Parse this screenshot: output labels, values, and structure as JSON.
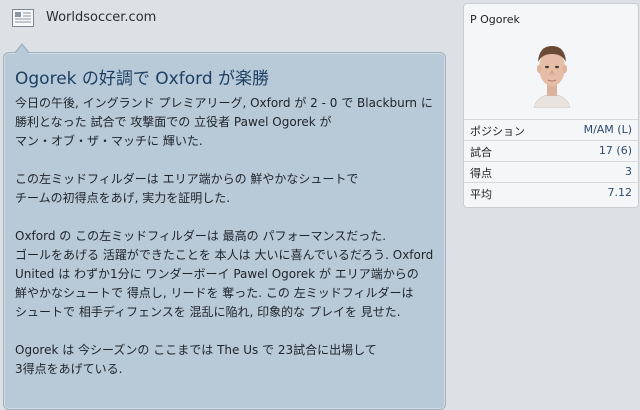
{
  "news": {
    "source": "Worldsoccer.com",
    "headline": "Ogorek の好調で Oxford が楽勝",
    "paragraphs": [
      [
        "今日の午後, イングランド プレミアリーグ, Oxford が 2 - 0 で Blackburn に",
        "勝利となった 試合で 攻撃面での 立役者 Pawel Ogorek が",
        "マン・オブ・ザ・マッチに 輝いた."
      ],
      [
        "この左ミッドフィルダーは エリア端からの 鮮やかなシュートで",
        "チームの初得点をあげ, 実力を証明した."
      ],
      [
        "Oxford の この左ミッドフィルダーは 最高の パフォーマンスだった.",
        "ゴールをあげる 活躍ができたことを 本人は 大いに喜んでいるだろう. Oxford",
        "United は わずか1分に ワンダーボーイ Pawel Ogorek が エリア端からの",
        "鮮やかなシュートで 得点し, リードを 奪った. この 左ミッドフィルダーは",
        "シュートで 相手ディフェンスを 混乱に陥れ, 印象的な プレイを 見せた."
      ],
      [
        "Ogorek は 今シーズンの ここまでは The Us で 23試合に出場して",
        "3得点をあげている."
      ]
    ]
  },
  "player": {
    "name": "P Ogorek",
    "stats": [
      {
        "label": "ポジション",
        "value": "M/AM (L)"
      },
      {
        "label": "試合",
        "value": "17 (6)"
      },
      {
        "label": "得点",
        "value": "3"
      },
      {
        "label": "平均",
        "value": "7.12"
      }
    ]
  },
  "icons": {
    "source": "newspaper-icon",
    "photo": "player-portrait"
  },
  "colors": {
    "headline": "#1d3f63",
    "bubble": "#b8c9d7",
    "value": "#2d4c6d"
  }
}
